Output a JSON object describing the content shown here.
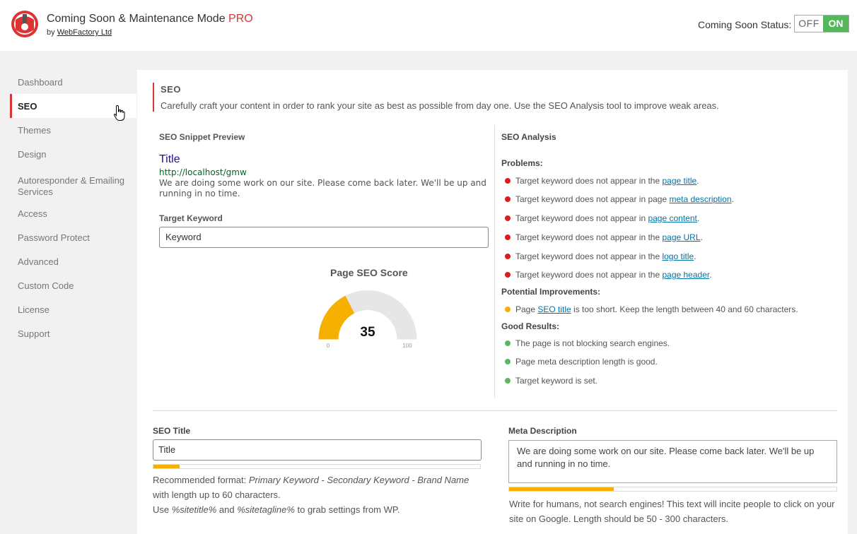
{
  "header": {
    "app_title": "Coming Soon & Maintenance Mode",
    "app_title_pro": "PRO",
    "by": "by",
    "company": "WebFactory Ltd",
    "status_label": "Coming Soon Status:",
    "toggle_off": "OFF",
    "toggle_on": "ON"
  },
  "colors": {
    "accent": "#dd3333",
    "on_green": "#55b65c",
    "bad": "#e01b1b",
    "warn": "#f5b000",
    "good": "#5cb85c",
    "link": "#0073aa"
  },
  "sidebar": {
    "items": [
      {
        "label": "Dashboard"
      },
      {
        "label": "SEO",
        "active": true
      },
      {
        "label": "Themes"
      },
      {
        "label": "Design"
      },
      {
        "label": "Autoresponder & Emailing Services"
      },
      {
        "label": "Access"
      },
      {
        "label": "Password Protect"
      },
      {
        "label": "Advanced"
      },
      {
        "label": "Custom Code"
      },
      {
        "label": "License"
      },
      {
        "label": "Support"
      }
    ]
  },
  "section": {
    "title": "SEO",
    "description": "Carefully craft your content in order to rank your site as best as possible from day one. Use the SEO Analysis tool to improve weak areas."
  },
  "snippet": {
    "heading": "SEO Snippet Preview",
    "title": "Title",
    "url": "http://localhost/gmw",
    "description": "We are doing some work on our site. Please come back later. We'll be up and running in no time."
  },
  "keyword": {
    "label": "Target Keyword",
    "value": "Keyword"
  },
  "score": {
    "title": "Page SEO Score",
    "value": 35,
    "min": "0",
    "max": "100"
  },
  "analysis": {
    "heading": "SEO Analysis",
    "problems_label": "Problems:",
    "problems": [
      {
        "pre": "Target keyword does not appear in the ",
        "link": "page title",
        "post": "."
      },
      {
        "pre": "Target keyword does not appear in page ",
        "link": "meta description",
        "post": "."
      },
      {
        "pre": "Target keyword does not appear in ",
        "link": "page content",
        "post": "."
      },
      {
        "pre": "Target keyword does not appear in the ",
        "link": "page URL",
        "post": "."
      },
      {
        "pre": "Target keyword does not appear in the ",
        "link": "logo title",
        "post": "."
      },
      {
        "pre": "Target keyword does not appear in the ",
        "link": "page header",
        "post": "."
      }
    ],
    "improvements_label": "Potential Improvements:",
    "improvements": [
      {
        "pre": "Page ",
        "link": "SEO title",
        "post": " is too short. Keep the length between 40 and 60 characters."
      }
    ],
    "good_label": "Good Results:",
    "good": [
      {
        "text": "The page is not blocking search engines."
      },
      {
        "text": "Page meta description length is good."
      },
      {
        "text": "Target keyword is set."
      }
    ]
  },
  "seo_title": {
    "label": "SEO Title",
    "value": "Title",
    "progress": 0.08,
    "help_prefix": "Recommended format: ",
    "help_format": "Primary Keyword - Secondary Keyword - Brand Name",
    "help_suffix": " with length up to 60 characters.",
    "help2_prefix": "Use ",
    "help2_var1": "%sitetitle%",
    "help2_mid": " and ",
    "help2_var2": "%sitetagline%",
    "help2_suffix": " to grab settings from WP."
  },
  "meta_description": {
    "label": "Meta Description",
    "value": "We are doing some work on our site. Please come back later. We'll be up and running in no time.",
    "progress": 0.32,
    "help": "Write for humans, not search engines! This text will incite people to click on your site on Google. Length should be 50 - 300 characters."
  }
}
